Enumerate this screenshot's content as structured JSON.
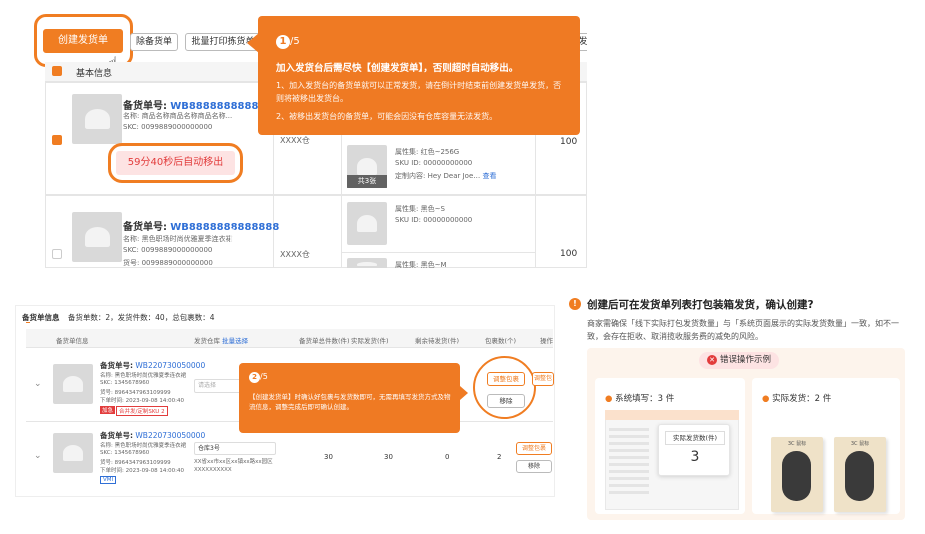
{
  "top": {
    "create_btn": "创建发货单",
    "remove_btn": "除备货单",
    "print_btn": "批量打印拣货单",
    "edge_btn": "发",
    "basic_info": "基本信息",
    "rows": [
      {
        "order_label": "备货单号:",
        "order_no": "WB8888888888888",
        "name": "名称: 商品名称商品名称商品名称...",
        "skc": "SKC: 0099889000000000",
        "warehouse": "XXXX仓",
        "qty": "100",
        "timer": "59分40秒后自动移出",
        "attr": "属性集: 红色~256G",
        "sku": "SKU ID: 00000000000",
        "custom": "定制内容: Hey Dear Joe…",
        "view": "查看",
        "count_badge": "共3张"
      },
      {
        "order_label": "备货单号:",
        "order_no": "WB8888888888888",
        "name": "名称: 黑色职场时尚优雅夏季连衣裙",
        "skc": "SKC: 0099889000000000",
        "goods": "货号: 0099889000000000",
        "warehouse": "XXXX仓",
        "qty": "100",
        "attr": "属性集: 黑色~S",
        "sku": "SKU ID: 00000000000",
        "attr2": "属性集: 黑色~M"
      }
    ],
    "tip": {
      "step": "1",
      "total": "/5",
      "title": "加入发货台后需尽快【创建发货单】，否则超时自动移出。",
      "line1": "1、加入发货台的备货单就可以正常发货，请在倒计时结束前创建发货单发货，否则将被移出发货台。",
      "line2": "2、被移出发货台的备货单，可能会因没有仓库容量无法发货。"
    }
  },
  "bottom_left": {
    "summary_title": "备货单信息",
    "summary_text": "备货单数：2，发货件数：40，总包裹数：4",
    "headers": [
      "备货单信息",
      "发货仓库",
      "批量选择",
      "备货单总件数(件)",
      "实际发货(件)",
      "剩余待发货(件)",
      "包裹数(个)",
      "操作"
    ],
    "rows": [
      {
        "order_label": "备货单号:",
        "order_no": "WB220730050000",
        "name": "名称: 黑色职场时尚优雅夏季连衣裙",
        "skc": "SKC: 1345678960",
        "goods": "货号: 8964347963109999",
        "date": "下单时间: 2023-09-08 14:00:40",
        "tag1": "加急",
        "tag2": "合并发/定制SKU 2",
        "select": "请选择",
        "btn1": "调整包裹",
        "btn2": "移除"
      },
      {
        "order_label": "备货单号:",
        "order_no": "WB220730050000",
        "name": "名称: 黑色职场时尚优雅夏季连衣裙",
        "skc": "SKC: 1345678960",
        "goods": "货号: 8964347963109999",
        "date": "下单时间: 2023-09-08 14:00:40",
        "tag": "VMI",
        "warehouse": "仓库3号",
        "address": "XX省xx市xx区xx镇xx路xx园区XXXXXXXXXX",
        "total": "30",
        "actual": "30",
        "remain": "0",
        "packages": "2",
        "btn1": "调整包裹",
        "btn2": "移除"
      }
    ],
    "tip": {
      "step": "2",
      "total": "/5",
      "text": "【创建发货单】时确认好包裹与发货数即可，无需再填写发货方式及物流信息，调整完成后即可确认创建。"
    }
  },
  "bottom_right": {
    "title": "创建后可在发货单列表打包装箱发货，确认创建?",
    "desc": "商家需确保「线下实际打包发货数量」与「系统页面展示的实际发货数量」一致，如不一致，会存在拒收、取消揽收服务费的减免的风险。",
    "wrong_badge": "错误操作示例",
    "system_label": "系统填写：3 件",
    "actual_label": "实际发货：2 件",
    "popup_label": "实际发货数(件)",
    "popup_value": "3",
    "mouse_label": "3C 鼠标"
  }
}
